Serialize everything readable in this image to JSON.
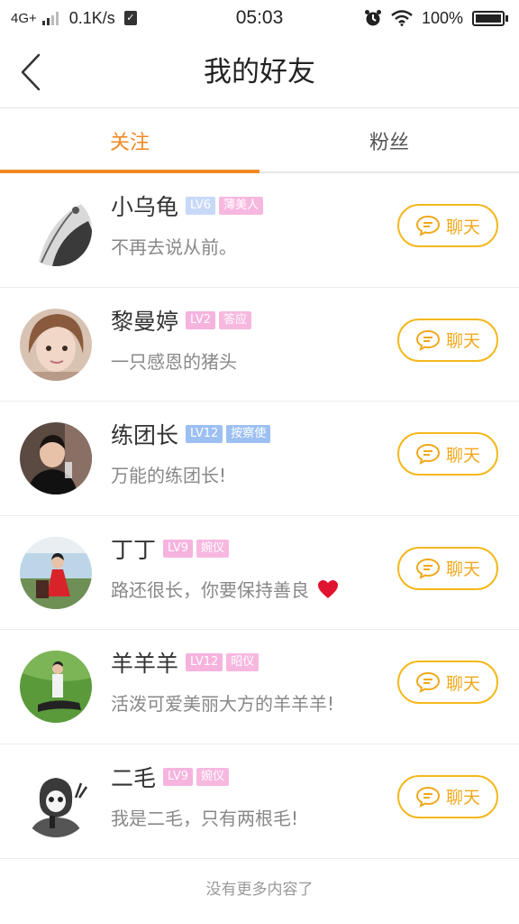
{
  "status_bar": {
    "network": "4G+",
    "speed": "0.1K/s",
    "time": "05:03",
    "battery": "100%"
  },
  "header": {
    "title": "我的好友"
  },
  "tabs": [
    {
      "label": "关注",
      "active": true
    },
    {
      "label": "粉丝",
      "active": false
    }
  ],
  "friends": [
    {
      "name": "小乌龟",
      "level": "LV6",
      "title": "薄美人",
      "status": "不再去说从前。",
      "level_color": "#c8d9f8",
      "title_color": "#f7b8e0"
    },
    {
      "name": "黎曼婷",
      "level": "LV2",
      "title": "答应",
      "status": "一只感恩的猪头",
      "level_color": "#f5b3de",
      "title_color": "#f7b8e0"
    },
    {
      "name": "练团长",
      "level": "LV12",
      "title": "按察使",
      "status": "万能的练团长!",
      "level_color": "#9cc0f2",
      "title_color": "#9cc0f2"
    },
    {
      "name": "丁丁",
      "level": "LV9",
      "title": "婉仪",
      "status": "路还很长，你要保持善良",
      "level_color": "#f5b3de",
      "title_color": "#f7b8e0",
      "heart": true
    },
    {
      "name": "羊羊羊",
      "level": "LV12",
      "title": "昭仪",
      "status": "活泼可爱美丽大方的羊羊羊!",
      "level_color": "#f5b3de",
      "title_color": "#f7b8e0"
    },
    {
      "name": "二毛",
      "level": "LV9",
      "title": "婉仪",
      "status": "我是二毛，只有两根毛!",
      "level_color": "#f5b3de",
      "title_color": "#f7b8e0"
    }
  ],
  "chat_label": "聊天",
  "footer": {
    "end_text": "没有更多内容了"
  },
  "colors": {
    "accent": "#f08a24",
    "chat": "#f3b81c"
  }
}
